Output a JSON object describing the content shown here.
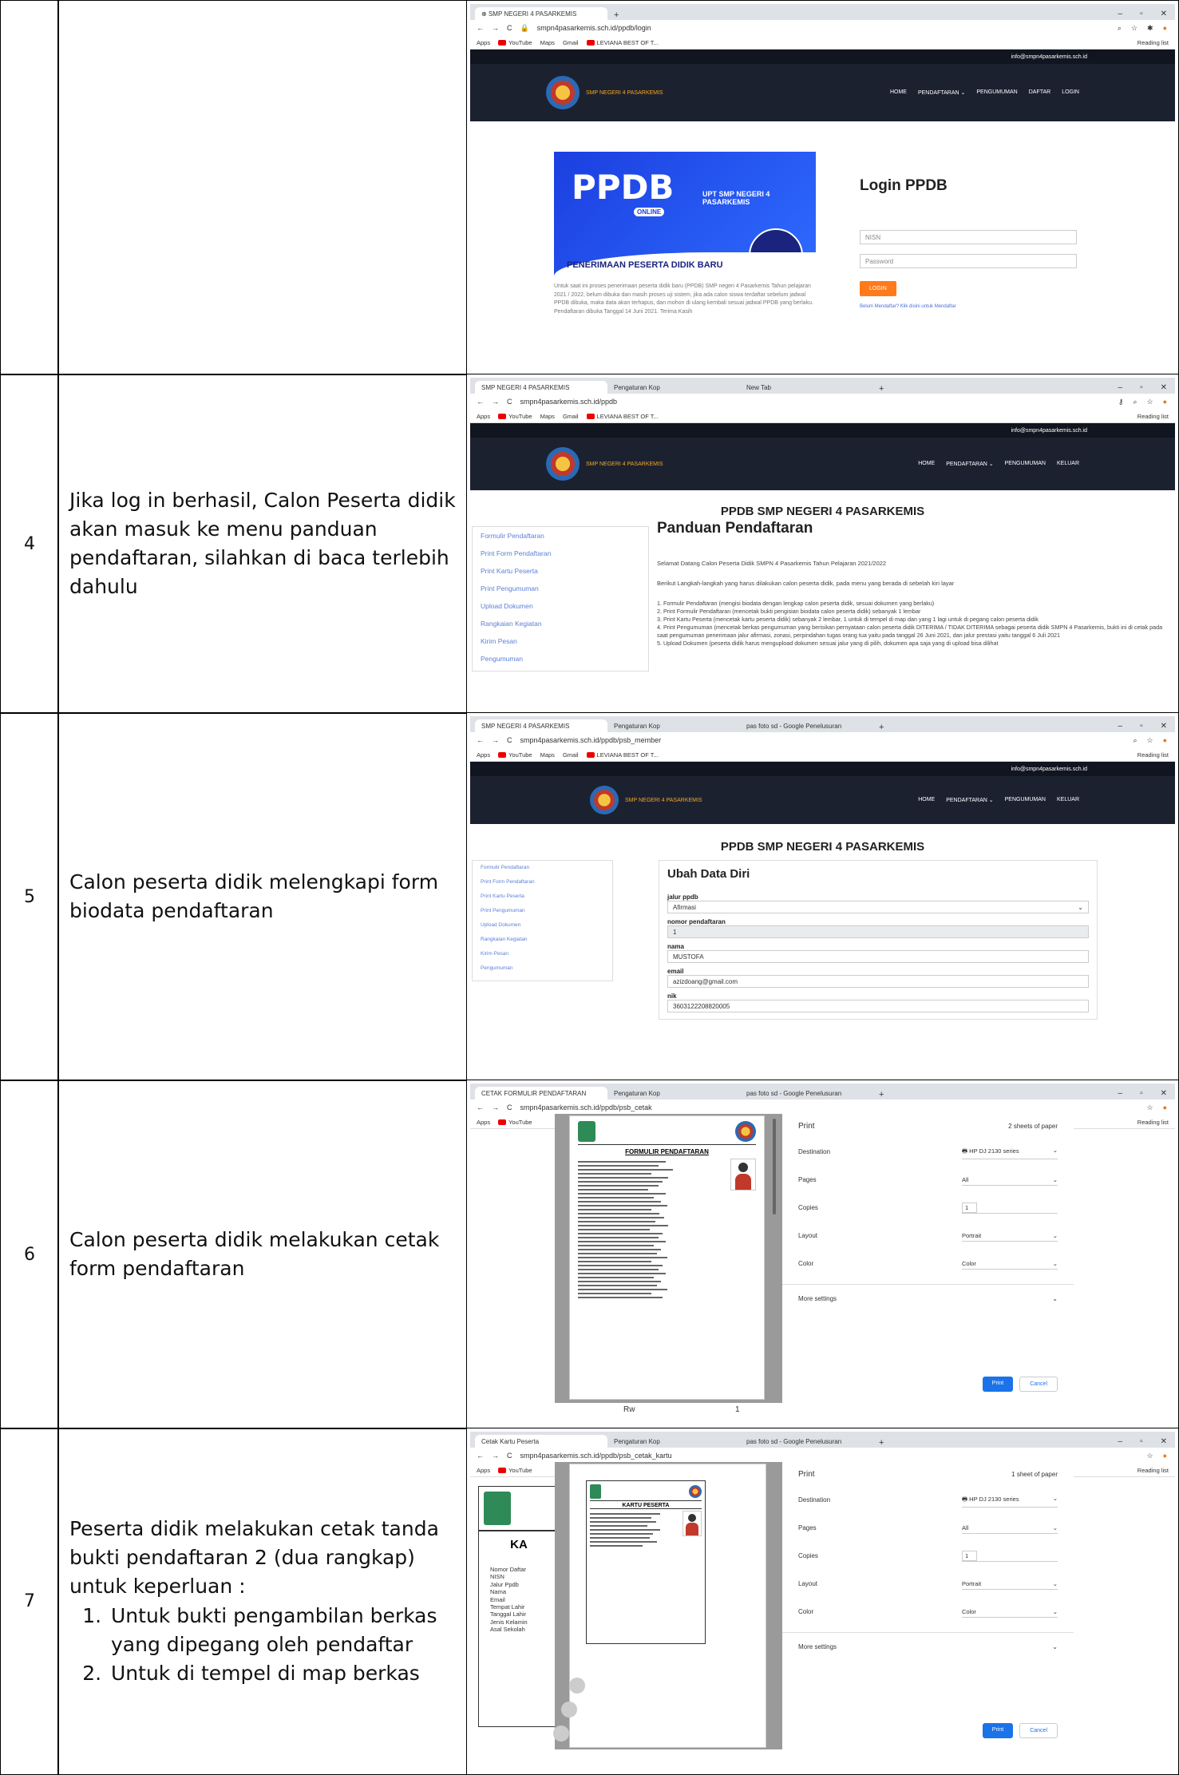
{
  "rows": [
    {
      "num": "",
      "desc": ""
    },
    {
      "num": "4",
      "desc": "Jika log in berhasil, Calon Peserta didik akan masuk ke menu panduan pendaftaran, silahkan di baca terlebih dahulu"
    },
    {
      "num": "5",
      "desc": "Calon peserta didik melengkapi form biodata pendaftaran"
    },
    {
      "num": "6",
      "desc": "Calon peserta didik melakukan cetak form pendaftaran"
    },
    {
      "num": "7",
      "desc_intro": "Peserta didik melakukan cetak tanda bukti pendaftaran 2 (dua rangkap) untuk keperluan :",
      "desc_items": [
        "Untuk bukti pengambilan berkas yang dipegang oleh pendaftar",
        "Untuk di tempel di map berkas"
      ]
    }
  ],
  "browser": {
    "bookmarks": [
      "Apps",
      "YouTube",
      "Maps",
      "Gmail",
      "LEVIANA BEST OF T..."
    ],
    "reading_list": "Reading list"
  },
  "site": {
    "email": "info@smpn4pasarkemis.sch.id",
    "brand": "SMP NEGERI 4 PASARKEMIS",
    "menu1": [
      "HOME",
      "PENDAFTARAN ⌄",
      "PENGUMUMAN",
      "DAFTAR",
      "LOGIN"
    ],
    "menu2": [
      "HOME",
      "PENDAFTARAN ⌄",
      "PENGUMUMAN",
      "KELUAR"
    ],
    "page_title": "PPDB SMP NEGERI 4 PASARKEMIS",
    "sidebar": [
      "Formulir Pendaftaran",
      "Print Form Pendaftaran",
      "Print Kartu Peserta",
      "Print Pengumuman",
      "Upload Dokumen",
      "Rangkaian Kegiatan",
      "Kirim Pesan",
      "Pengumuman"
    ]
  },
  "shot1": {
    "tab": "SMP NEGERI 4 PASARKEMIS",
    "url": "smpn4pasarkemis.sch.id/ppdb/login",
    "banner_title": "PPDB",
    "banner_sub": "ONLINE",
    "banner_school": "UPT SMP NEGERI 4 PASARKEMIS",
    "banner_caption": "PENERIMAAN PESERTA DIDIK BARU",
    "notice": "Untuk saat ini proses penerimaan peserta didik baru (PPDB) SMP negeri 4 Pasarkemis Tahun pelajaran 2021 / 2022, belum dibuka dan masih proses uji sistem, jika ada calon siswa terdaftar sebelum jadwal PPDB dibuka, maka data akan terhapus, dan mohon di ulang kembali sesuai jadwal PPDB yang berlaku. Pendaftaran dibuka Tanggal 14 Juni 2021. Terima Kasih",
    "login_title": "Login PPDB",
    "nisn_placeholder": "NISN",
    "password_placeholder": "Password",
    "login_btn": "LOGIN",
    "register_link": "Belum Mendaftar? Klik disini untuk Mendaftar"
  },
  "shot2": {
    "tabs": [
      "SMP NEGERI 4 PASARKEMIS",
      "Pengaturan Kop",
      "New Tab"
    ],
    "url": "smpn4pasarkemis.sch.id/ppdb",
    "heading": "Panduan Pendaftaran",
    "welcome": "Selamat Datang Calon Peserta Didik SMPN 4 Pasarkemis Tahun Pelajaran 2021/2022",
    "intro": "Berikut Langkah-langkah yang harus dilakukan calon peserta didik, pada menu yang berada di sebelah kiri layar",
    "steps": [
      "1. Formulir Pendaftaran (mengisi biodata dengan lengkap calon peserta didik, sesuai dokumen yang berlaku)",
      "2. Print Formulir Pendaftaran (mencetak bukti pengisian biodata calon peserta didik) sebanyak 1 lembar",
      "3. Print Kartu Peserta (mencetak kartu peserta didik) sebanyak 2 lembar, 1 untuk di tempel di map dan yang 1 lagi untuk di pegang calon peserta didik",
      "4. Print Pengumuman (mencetak berkas pengumuman yang berisikan pernyataan calon peserta didik DITERIMA / TIDAK DITERIMA sebagai peserta didik SMPN 4 Pasarkemis, bukti ini di cetak pada saat pengumuman penerimaan jalur afirmasi, zonasi, perpindahan tugas orang tua yaitu pada tanggal 26 Juni 2021, dan jalur prestasi yaitu tanggal 6 Juli 2021",
      "5. Upload Dokumen (peserta didik harus mengupload dokumen sesuai jalur yang di pilih, dokumen apa saja yang di upload bisa dilihat"
    ]
  },
  "shot3": {
    "tabs": [
      "SMP NEGERI 4 PASARKEMIS",
      "Pengaturan Kop",
      "pas foto sd - Google Penelusuran"
    ],
    "url": "smpn4pasarkemis.sch.id/ppdb/psb_member",
    "heading": "Ubah Data Diri",
    "fields": [
      {
        "label": "jalur ppdb",
        "value": "Afirmasi"
      },
      {
        "label": "nomor pendaftaran",
        "value": "1"
      },
      {
        "label": "nama",
        "value": "MUSTOFA"
      },
      {
        "label": "email",
        "value": "azizdoang@gmail.com"
      },
      {
        "label": "nik",
        "value": "3603122208820005"
      }
    ]
  },
  "shot4": {
    "tabs": [
      "CETAK FORMULIR PENDAFTARAN",
      "Pengaturan Kop",
      "pas foto sd - Google Penelusuran"
    ],
    "url": "smpn4pasarkemis.sch.id/ppdb/psb_cetak",
    "doc_title": "FORMULIR PENDAFTARAN",
    "print_title": "Print",
    "sheets": "2 sheets of paper",
    "settings": [
      {
        "label": "Destination",
        "value": "HP DJ 2130 series"
      },
      {
        "label": "Pages",
        "value": "All"
      },
      {
        "label": "Copies",
        "value": "1"
      },
      {
        "label": "Layout",
        "value": "Portrait"
      },
      {
        "label": "Color",
        "value": "Color"
      }
    ],
    "more": "More settings",
    "print_btn": "Print",
    "cancel_btn": "Cancel",
    "footer_left": "Rw",
    "footer_right": "1"
  },
  "shot5": {
    "tabs": [
      "Cetak Kartu Peserta",
      "Pengaturan Kop",
      "pas foto sd - Google Penelusuran"
    ],
    "url": "smpn4pasarkemis.sch.id/ppdb/psb_cetak_kartu",
    "doc_title": "KARTU PESERTA",
    "print_title": "Print",
    "sheets": "1 sheet of paper",
    "settings": [
      {
        "label": "Destination",
        "value": "HP DJ 2130 series"
      },
      {
        "label": "Pages",
        "value": "All"
      },
      {
        "label": "Copies",
        "value": "1"
      },
      {
        "label": "Layout",
        "value": "Portrait"
      },
      {
        "label": "Color",
        "value": "Color"
      }
    ],
    "more": "More settings",
    "print_btn": "Print",
    "cancel_btn": "Cancel",
    "bg_labels": [
      "Nomor Daftar",
      "NISN",
      "Jalur Ppdb",
      "Nama",
      "Email",
      "Tempat Lahir",
      "Tanggal Lahir",
      "Jenis Kelamin",
      "Asal Sekolah"
    ],
    "bg_head": "KA"
  }
}
